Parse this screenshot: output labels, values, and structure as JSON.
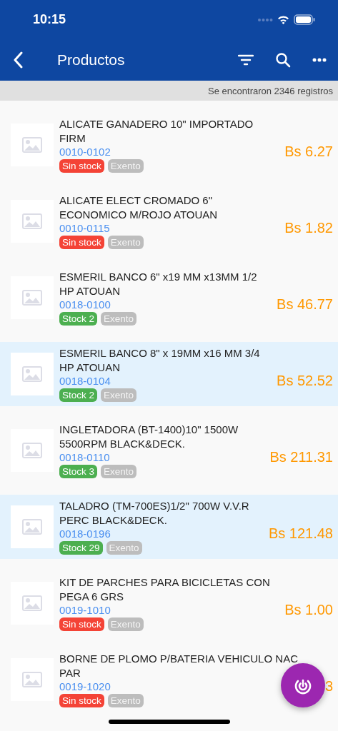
{
  "status_bar": {
    "time": "10:15"
  },
  "nav_bar": {
    "title": "Productos"
  },
  "results": {
    "text": "Se encontraron 2346 registros"
  },
  "products": [
    {
      "name": "ALICATE GANADERO 10\" IMPORTADO FIRM",
      "code": "0010-0102",
      "stock": {
        "kind": "out",
        "label": "Sin stock"
      },
      "tax": "Exento",
      "price": "Bs 6.27",
      "selected": false
    },
    {
      "name": "ALICATE ELECT CROMADO 6\" ECONOMICO M/ROJO ATOUAN",
      "code": "0010-0115",
      "stock": {
        "kind": "out",
        "label": "Sin stock"
      },
      "tax": "Exento",
      "price": "Bs 1.82",
      "selected": false
    },
    {
      "name": "ESMERIL BANCO 6\" x19 MM x13MM 1/2 HP ATOUAN",
      "code": "0018-0100",
      "stock": {
        "kind": "in",
        "label": "Stock 2"
      },
      "tax": "Exento",
      "price": "Bs 46.77",
      "selected": false
    },
    {
      "name": "ESMERIL BANCO 8\" x 19MM x16 MM 3/4 HP ATOUAN",
      "code": "0018-0104",
      "stock": {
        "kind": "in",
        "label": "Stock 2"
      },
      "tax": "Exento",
      "price": "Bs 52.52",
      "selected": true
    },
    {
      "name": "INGLETADORA (BT-1400)10\" 1500W 5500RPM BLACK&DECK.",
      "code": "0018-0110",
      "stock": {
        "kind": "in",
        "label": "Stock 3"
      },
      "tax": "Exento",
      "price": "Bs 211.31",
      "selected": false
    },
    {
      "name": "TALADRO (TM-700ES)1/2\" 700W V.V.R PERC BLACK&DECK.",
      "code": "0018-0196",
      "stock": {
        "kind": "in",
        "label": "Stock 29"
      },
      "tax": "Exento",
      "price": "Bs 121.48",
      "selected": true
    },
    {
      "name": "KIT DE PARCHES PARA BICICLETAS CON PEGA 6 GRS",
      "code": "0019-1010",
      "stock": {
        "kind": "out",
        "label": "Sin stock"
      },
      "tax": "Exento",
      "price": "Bs 1.00",
      "selected": false
    },
    {
      "name": "BORNE DE PLOMO P/BATERIA VEHICULO NAC PAR",
      "code": "0019-1020",
      "stock": {
        "kind": "out",
        "label": "Sin stock"
      },
      "tax": "Exento",
      "price": "3",
      "selected": false
    }
  ]
}
